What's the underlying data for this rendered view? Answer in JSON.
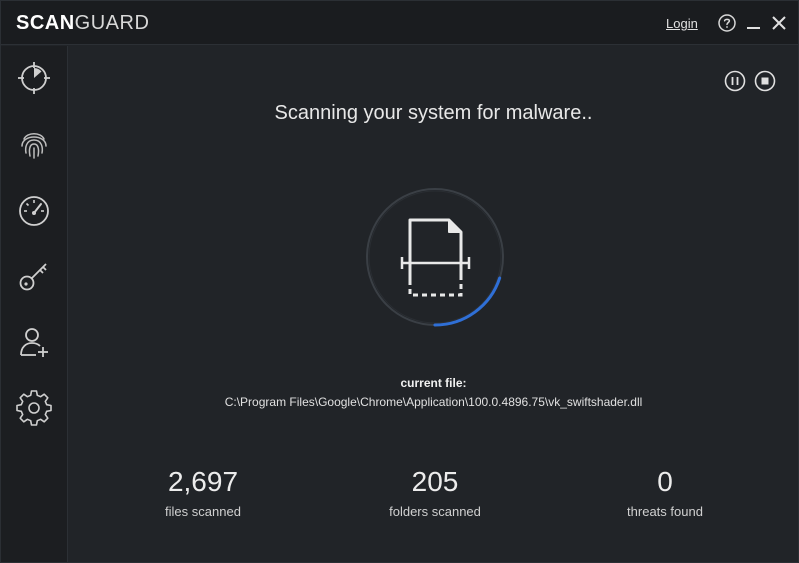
{
  "titlebar": {
    "brand_bold": "SCAN",
    "brand_light": "GUARD",
    "login_label": "Login"
  },
  "sidebar": {
    "items": [
      {
        "icon": "antivirus-scan-icon"
      },
      {
        "icon": "fingerprint-icon"
      },
      {
        "icon": "speedometer-icon"
      },
      {
        "icon": "key-icon"
      },
      {
        "icon": "add-user-icon"
      },
      {
        "icon": "gear-icon"
      }
    ]
  },
  "scan": {
    "heading": "Scanning your system for malware..",
    "current_file_label": "current file:",
    "current_file_path": "C:\\Program Files\\Google\\Chrome\\Application\\100.0.4896.75\\vk_swiftshader.dll",
    "progress": 0.2
  },
  "stats": [
    {
      "value": "2,697",
      "label": "files scanned"
    },
    {
      "value": "205",
      "label": "folders scanned"
    },
    {
      "value": "0",
      "label": "threats found"
    }
  ],
  "colors": {
    "background": "#212428",
    "sidebar": "#1c1e21",
    "progress_accent": "#2f6fd6",
    "ring": "#3a3f45"
  }
}
